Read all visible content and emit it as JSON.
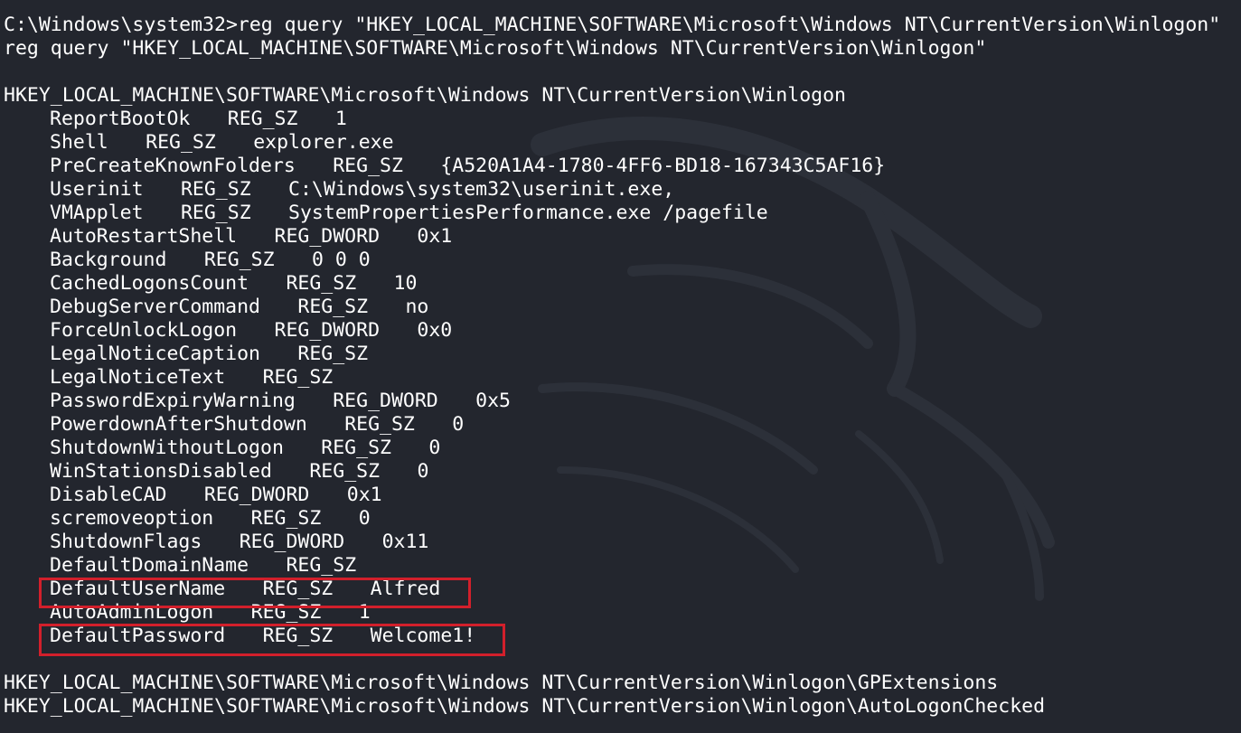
{
  "terminal": {
    "prompt": "C:\\Windows\\system32>reg query \"HKEY_LOCAL_MACHINE\\SOFTWARE\\Microsoft\\Windows NT\\CurrentVersion\\Winlogon\"",
    "echo": "reg query \"HKEY_LOCAL_MACHINE\\SOFTWARE\\Microsoft\\Windows NT\\CurrentVersion\\Winlogon\"",
    "key_path": "HKEY_LOCAL_MACHINE\\SOFTWARE\\Microsoft\\Windows NT\\CurrentVersion\\Winlogon",
    "values": [
      {
        "name": "ReportBootOk",
        "type": "REG_SZ",
        "data": "1"
      },
      {
        "name": "Shell",
        "type": "REG_SZ",
        "data": "explorer.exe"
      },
      {
        "name": "PreCreateKnownFolders",
        "type": "REG_SZ",
        "data": "{A520A1A4-1780-4FF6-BD18-167343C5AF16}"
      },
      {
        "name": "Userinit",
        "type": "REG_SZ",
        "data": "C:\\Windows\\system32\\userinit.exe,"
      },
      {
        "name": "VMApplet",
        "type": "REG_SZ",
        "data": "SystemPropertiesPerformance.exe /pagefile"
      },
      {
        "name": "AutoRestartShell",
        "type": "REG_DWORD",
        "data": "0x1"
      },
      {
        "name": "Background",
        "type": "REG_SZ",
        "data": "0 0 0"
      },
      {
        "name": "CachedLogonsCount",
        "type": "REG_SZ",
        "data": "10"
      },
      {
        "name": "DebugServerCommand",
        "type": "REG_SZ",
        "data": "no"
      },
      {
        "name": "ForceUnlockLogon",
        "type": "REG_DWORD",
        "data": "0x0"
      },
      {
        "name": "LegalNoticeCaption",
        "type": "REG_SZ",
        "data": ""
      },
      {
        "name": "LegalNoticeText",
        "type": "REG_SZ",
        "data": ""
      },
      {
        "name": "PasswordExpiryWarning",
        "type": "REG_DWORD",
        "data": "0x5"
      },
      {
        "name": "PowerdownAfterShutdown",
        "type": "REG_SZ",
        "data": "0"
      },
      {
        "name": "ShutdownWithoutLogon",
        "type": "REG_SZ",
        "data": "0"
      },
      {
        "name": "WinStationsDisabled",
        "type": "REG_SZ",
        "data": "0"
      },
      {
        "name": "DisableCAD",
        "type": "REG_DWORD",
        "data": "0x1"
      },
      {
        "name": "scremoveoption",
        "type": "REG_SZ",
        "data": "0"
      },
      {
        "name": "ShutdownFlags",
        "type": "REG_DWORD",
        "data": "0x11"
      },
      {
        "name": "DefaultDomainName",
        "type": "REG_SZ",
        "data": ""
      },
      {
        "name": "DefaultUserName",
        "type": "REG_SZ",
        "data": "Alfred"
      },
      {
        "name": "AutoAdminLogon",
        "type": "REG_SZ",
        "data": "1"
      },
      {
        "name": "DefaultPassword",
        "type": "REG_SZ",
        "data": "Welcome1!"
      }
    ],
    "subkeys": [
      "HKEY_LOCAL_MACHINE\\SOFTWARE\\Microsoft\\Windows NT\\CurrentVersion\\Winlogon\\GPExtensions",
      "HKEY_LOCAL_MACHINE\\SOFTWARE\\Microsoft\\Windows NT\\CurrentVersion\\Winlogon\\AutoLogonChecked"
    ]
  },
  "colors": {
    "background": "#23262e",
    "text": "#ffffff",
    "highlight_border": "#d21f2b"
  },
  "icons": {
    "background_art": "kali-dragon-icon"
  }
}
